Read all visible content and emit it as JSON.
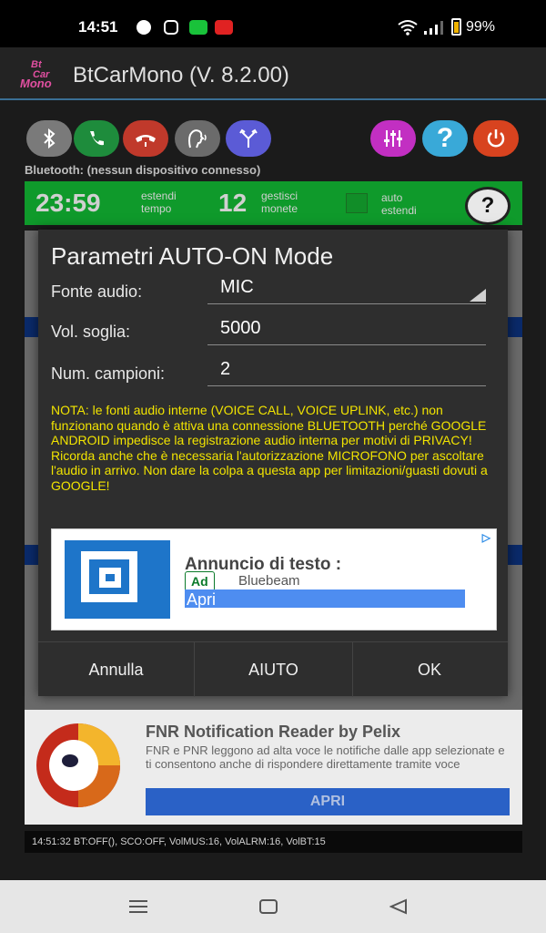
{
  "status_bar": {
    "time": "14:51",
    "battery": "99%"
  },
  "app": {
    "title": "BtCarMono (V. 8.2.00)",
    "logo_text": "Bt Car Mono"
  },
  "toolbar": {
    "icons": [
      "bluetooth-icon",
      "phone-bluetooth-icon",
      "hangup-icon",
      "voice-icon",
      "fork-icon",
      "equalizer-icon",
      "help-icon",
      "power-icon"
    ],
    "colors": {
      "gray": "#7a7a7a",
      "green": "#1e8c3c",
      "red": "#c0392b",
      "purple": "#5b5bd6",
      "magenta": "#c22fc2",
      "cyan": "#39a9d8",
      "orange": "#d8431f"
    }
  },
  "bluetooth_status": "Bluetooth: (nessun dispositivo connesso)",
  "green_bar": {
    "time": "23:59",
    "time_label_1": "estendi",
    "time_label_2": "tempo",
    "coins": "12",
    "coins_label_1": "gestisci",
    "coins_label_2": "monete",
    "auto_label_1": "auto",
    "auto_label_2": "estendi",
    "help": "?"
  },
  "dialog": {
    "title": "Parametri AUTO-ON Mode",
    "fields": [
      {
        "label": "Fonte audio:",
        "value": "MIC"
      },
      {
        "label": "Vol. soglia:",
        "value": "5000"
      },
      {
        "label": "Num. campioni:",
        "value": "2"
      }
    ],
    "note": "NOTA: le fonti audio interne (VOICE CALL, VOICE UPLINK, etc.) non funzionano quando è attiva una connessione BLUETOOTH perché GOOGLE ANDROID impedisce la registrazione audio interna per motivi di PRIVACY! Ricorda anche che è necessaria l'autorizzazione MICROFONO per ascoltare l'audio in arrivo. Non dare la colpa a questa app per limitazioni/guasti dovuti a GOOGLE!",
    "ad": {
      "title": "Annuncio di testo :",
      "badge": "Ad",
      "brand": "Bluebeam",
      "action": "Apri"
    },
    "buttons": {
      "cancel": "Annulla",
      "help": "AIUTO",
      "ok": "OK"
    }
  },
  "bottom_ad": {
    "title": "FNR Notification Reader by Pelix",
    "description": "FNR e PNR leggono ad alta voce le notifiche dalle app selezionate e ti consentono anche di rispondere direttamente tramite voce",
    "button": "APRI"
  },
  "log": "14:51:32 BT:OFF(), SCO:OFF, VolMUS:16, VolALRM:16, VolBT:15"
}
